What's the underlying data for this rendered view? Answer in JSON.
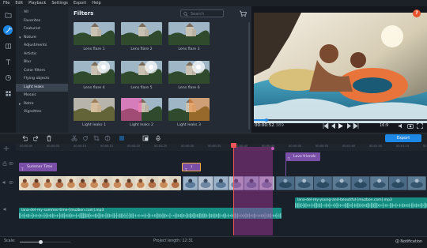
{
  "menu": [
    "File",
    "Edit",
    "Playback",
    "Settings",
    "Export",
    "Help"
  ],
  "categories": [
    {
      "label": "All",
      "kind": "plain"
    },
    {
      "label": "Favorites",
      "kind": "plain"
    },
    {
      "label": "Featured",
      "kind": "plain"
    },
    {
      "label": "Nature",
      "kind": "expanded"
    },
    {
      "label": "Adjustments",
      "kind": "plain"
    },
    {
      "label": "Artistic",
      "kind": "plain"
    },
    {
      "label": "Blur",
      "kind": "plain"
    },
    {
      "label": "Color filters",
      "kind": "plain"
    },
    {
      "label": "Flying objects",
      "kind": "plain"
    },
    {
      "label": "Light leaks",
      "kind": "selected"
    },
    {
      "label": "Mosaic",
      "kind": "plain"
    },
    {
      "label": "Retro",
      "kind": "collapsed"
    },
    {
      "label": "Vignettes",
      "kind": "plain"
    }
  ],
  "filters": {
    "title": "Filters",
    "search_placeholder": "Search",
    "items": [
      {
        "label": "Lens flare 1",
        "style": "plain"
      },
      {
        "label": "Lens flare 2",
        "style": "plain"
      },
      {
        "label": "Lens flare 3",
        "style": "plain"
      },
      {
        "label": "Lens flare 4",
        "style": "flare"
      },
      {
        "label": "Lens flare 5",
        "style": "flare"
      },
      {
        "label": "Lens flare 6",
        "style": "flare"
      },
      {
        "label": "Light leaks 1",
        "style": "leak-warm"
      },
      {
        "label": "Light leaks 2",
        "style": "leak-pink"
      },
      {
        "label": "Light leaks 3",
        "style": "leak-orange"
      }
    ]
  },
  "preview": {
    "time_main": "00:00:52",
    "time_ms": ".389",
    "aspect": "16:9",
    "help_label": "?"
  },
  "toolbar": {
    "export_label": "Export"
  },
  "ruler": [
    "00:00:00",
    "00:00:05",
    "00:00:10",
    "00:00:15",
    "00:00:20",
    "00:00:25",
    "00:00:30",
    "00:00:35",
    "00:00:40",
    "00:00:45",
    "00:00:50",
    "00:00:55",
    "00:01:00",
    "00:01:05",
    "00:01:10",
    "00:01:15"
  ],
  "clips": {
    "title1": "Summer Time",
    "title2": "Love friends",
    "small_clip": "?",
    "audio1": "lana-del-rey-summer-time-[muzbon.com].mp3",
    "audio2": "lana-del-rey-young-and-beautiful-[muzbon.com].mp3"
  },
  "status": {
    "scale_label": "Scale:",
    "scale_level": 0.4,
    "project_length": "Project length: 12:31",
    "notification": "Notification"
  },
  "colors": {
    "accent": "#1d87e5",
    "title_clip": "#7a4fa8",
    "audio_clip": "#148c82",
    "playhead": "#f05656",
    "help": "#e8542f"
  }
}
